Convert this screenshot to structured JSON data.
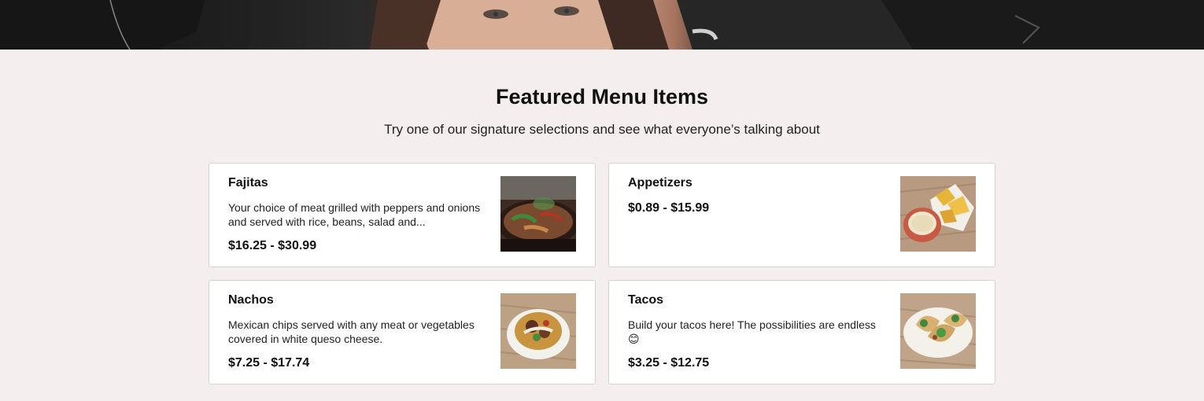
{
  "section": {
    "title": "Featured Menu Items",
    "subtitle": "Try one of our signature selections and see what everyone’s talking about"
  },
  "menu_items": [
    {
      "name": "Fajitas",
      "description": "Your choice of meat grilled with peppers and onions and served with rice, beans, salad and...",
      "price": "$16.25 - $30.99",
      "image_icon": "fajitas-photo"
    },
    {
      "name": "Appetizers",
      "description": "",
      "price": "$0.89 - $15.99",
      "image_icon": "chips-and-queso-photo"
    },
    {
      "name": "Nachos",
      "description": "Mexican chips served with any meat or vegetables covered in white queso cheese.",
      "price": "$7.25 - $17.74",
      "image_icon": "nachos-photo"
    },
    {
      "name": "Tacos",
      "description": "Build your tacos here! The possibilities are endless 😊",
      "price": "$3.25 - $12.75",
      "image_icon": "tacos-photo"
    }
  ],
  "colors": {
    "page_background": "#f4eeee",
    "card_background": "#ffffff",
    "card_border": "#d6d2d2"
  }
}
